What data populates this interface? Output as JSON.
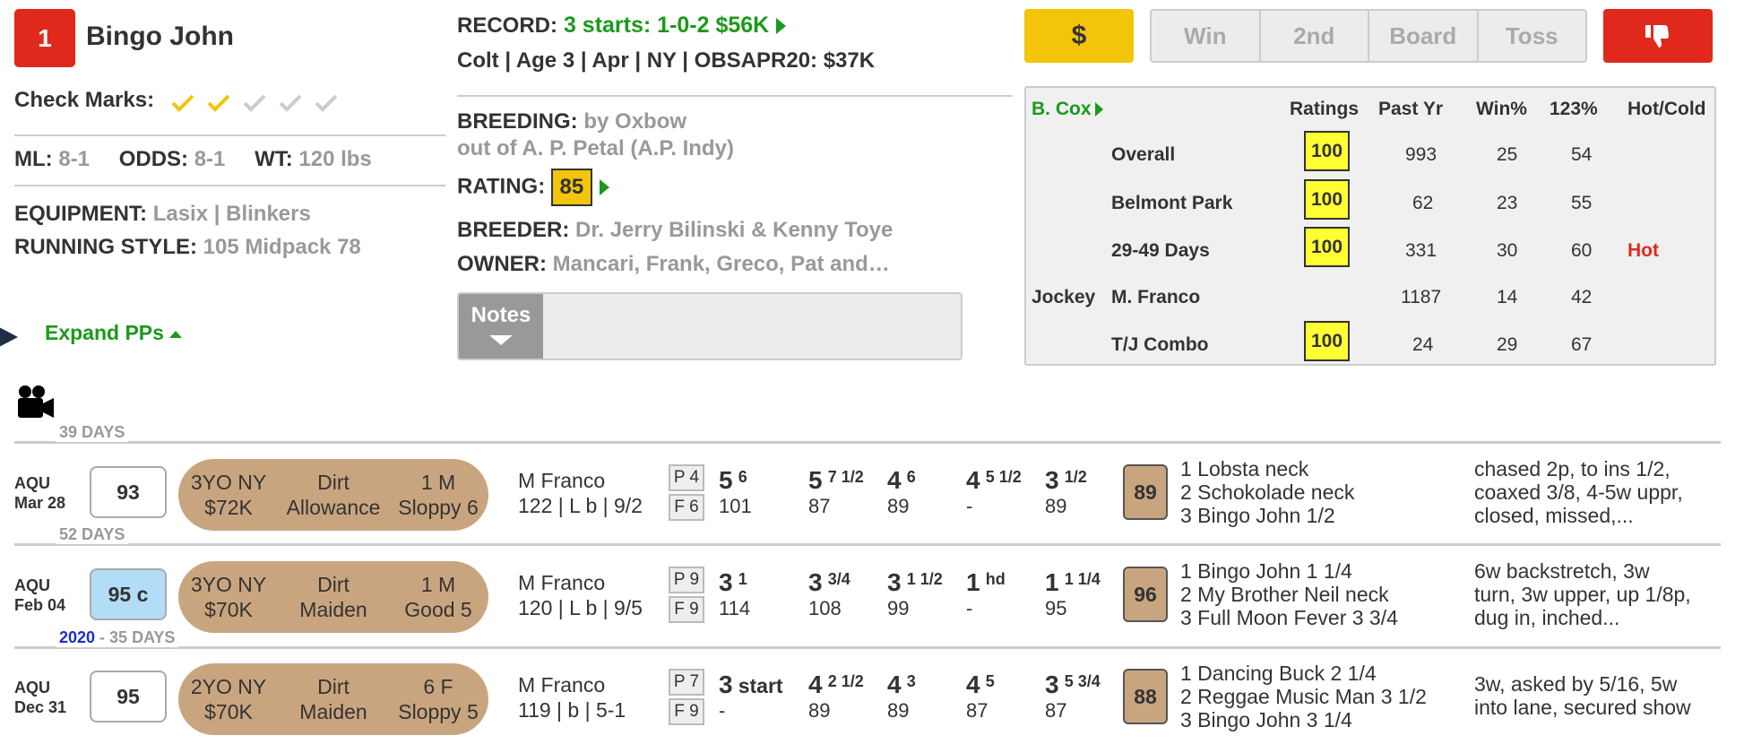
{
  "horse": {
    "number": "1",
    "name": "Bingo John",
    "check_marks_label": "Check Marks:",
    "ml_label": "ML:",
    "ml": "8-1",
    "odds_label": "ODDS:",
    "odds": "8-1",
    "wt_label": "WT:",
    "wt": "120 lbs",
    "equipment_label": "EQUIPMENT:",
    "equipment": "Lasix | Blinkers",
    "running_style_label": "RUNNING STYLE:",
    "running_style": "105 Midpack 78",
    "expand_label": "Expand PPs"
  },
  "record": {
    "label": "RECORD:",
    "value": "3 starts: 1-0-2 $56K",
    "description": "Colt | Age 3 | Apr | NY | OBSAPR20: $37K",
    "breeding_label": "BREEDING:",
    "sire": "by Oxbow",
    "dam": "out of A. P. Petal (A.P. Indy)",
    "rating_label": "RATING:",
    "rating": "85",
    "breeder_label": "BREEDER:",
    "breeder": "Dr. Jerry Bilinski & Kenny Toye",
    "owner_label": "OWNER:",
    "owner": "Mancari, Frank, Greco, Pat and…",
    "notes_label": "Notes"
  },
  "actions": {
    "dollar": "$",
    "win": "Win",
    "second": "2nd",
    "board": "Board",
    "toss": "Toss"
  },
  "stats": {
    "trainer": "B. Cox",
    "headers": [
      "Ratings",
      "Past Yr",
      "Win%",
      "123%",
      "Hot/Cold"
    ],
    "jockey_label": "Jockey",
    "rows": [
      {
        "name": "Overall",
        "rating": "100",
        "past": "993",
        "win": "25",
        "itm": "54",
        "hot": ""
      },
      {
        "name": "Belmont Park",
        "rating": "100",
        "past": "62",
        "win": "23",
        "itm": "55",
        "hot": ""
      },
      {
        "name": "29-49 Days",
        "rating": "100",
        "past": "331",
        "win": "30",
        "itm": "60",
        "hot": "Hot"
      },
      {
        "name": "M. Franco",
        "rating": "",
        "past": "1187",
        "win": "14",
        "itm": "42",
        "hot": ""
      },
      {
        "name": "T/J Combo",
        "rating": "100",
        "past": "24",
        "win": "29",
        "itm": "67",
        "hot": ""
      }
    ],
    "hot_color": "#e0291c"
  },
  "pps": {
    "separators": [
      {
        "year": "",
        "days": "39 DAYS"
      },
      {
        "year": "",
        "days": "52 DAYS"
      },
      {
        "year": "2020",
        "dash": " - ",
        "days": "35 DAYS"
      }
    ],
    "races": [
      {
        "track": "AQU",
        "date": "Mar 28",
        "speed": "93",
        "cond": "3YO NY",
        "purse": "$72K",
        "surface": "Dirt",
        "type": "Allowance",
        "dist": "1 M",
        "track_cond": "Sloppy 6",
        "jockey": "M Franco",
        "jockey_line": "122 | L b | 9/2",
        "post": "P 4",
        "field": "F 6",
        "calls": [
          {
            "pos": "5",
            "len": "6",
            "fig": "101"
          },
          {
            "pos": "5",
            "len": "7 1/2",
            "fig": "87"
          },
          {
            "pos": "4",
            "len": "6",
            "fig": "89"
          },
          {
            "pos": "4",
            "len": "5 1/2",
            "fig": "-"
          },
          {
            "pos": "3",
            "len": "1/2",
            "fig": "89"
          }
        ],
        "figure": "89",
        "finish": [
          "1 Lobsta neck",
          "2 Schokolade neck",
          "3 Bingo John 1/2"
        ],
        "comment": [
          "chased 2p, to ins 1/2,",
          "coaxed 3/8, 4-5w uppr,",
          "closed, missed,..."
        ]
      },
      {
        "track": "AQU",
        "date": "Feb 04",
        "speed": "95 c",
        "cond": "3YO NY",
        "purse": "$70K",
        "surface": "Dirt",
        "type": "Maiden",
        "dist": "1 M",
        "track_cond": "Good 5",
        "jockey": "M Franco",
        "jockey_line": "120 | L b | 9/5",
        "post": "P 9",
        "field": "F 9",
        "calls": [
          {
            "pos": "3",
            "len": "1",
            "fig": "114"
          },
          {
            "pos": "3",
            "len": "3/4",
            "fig": "108"
          },
          {
            "pos": "3",
            "len": "1 1/2",
            "fig": "99"
          },
          {
            "pos": "1",
            "len": "hd",
            "fig": "-"
          },
          {
            "pos": "1",
            "len": "1 1/4",
            "fig": "95"
          }
        ],
        "figure": "96",
        "finish": [
          "1 Bingo John 1 1/4",
          "2 My Brother Neil neck",
          "3 Full Moon Fever 3 3/4"
        ],
        "comment": [
          "6w backstretch, 3w",
          "turn, 3w upper, up 1/8p,",
          "dug in, inched..."
        ]
      },
      {
        "track": "AQU",
        "date": "Dec 31",
        "speed": "95",
        "cond": "2YO NY",
        "purse": "$70K",
        "surface": "Dirt",
        "type": "Maiden",
        "dist": "6 F",
        "track_cond": "Sloppy 5",
        "jockey": "M Franco",
        "jockey_line": "119 | b | 5-1",
        "post": "P 7",
        "field": "F 9",
        "calls": [
          {
            "pos": "3",
            "len": "start",
            "fig": "-"
          },
          {
            "pos": "4",
            "len": "2 1/2",
            "fig": "89"
          },
          {
            "pos": "4",
            "len": "3",
            "fig": "89"
          },
          {
            "pos": "4",
            "len": "5",
            "fig": "87"
          },
          {
            "pos": "3",
            "len": "5 3/4",
            "fig": "87"
          }
        ],
        "figure": "88",
        "finish": [
          "1 Dancing Buck 2 1/4",
          "2 Reggae Music Man 3 1/2",
          "3 Bingo John 3 1/4"
        ],
        "comment": [
          "3w, asked by 5/16, 5w",
          "into lane, secured show"
        ]
      }
    ]
  }
}
